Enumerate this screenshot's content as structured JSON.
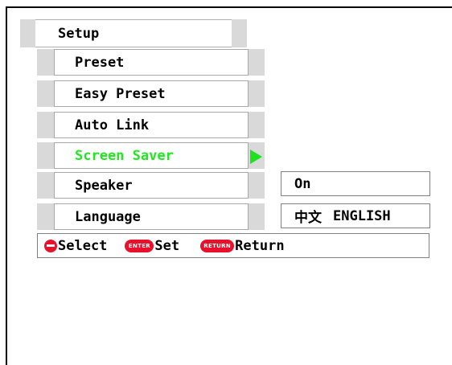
{
  "header": {
    "title": "Setup"
  },
  "menu": {
    "items": [
      {
        "label": "Preset",
        "selected": false
      },
      {
        "label": "Easy Preset",
        "selected": false
      },
      {
        "label": "Auto Link",
        "selected": false
      },
      {
        "label": "Screen Saver",
        "selected": true
      },
      {
        "label": "Speaker",
        "selected": false
      },
      {
        "label": "Language",
        "selected": false
      }
    ],
    "selected_color": "#22e622"
  },
  "values": {
    "speaker": "On",
    "language_chinese": "中文",
    "language_english": "ENGLISH"
  },
  "footer": {
    "select_label": "Select",
    "enter_key": "ENTER",
    "set_label": "Set",
    "return_key": "RETURN",
    "return_label": "Return"
  },
  "colors": {
    "key_red": "#e8102a",
    "arrow_green": "#1fe21f"
  }
}
